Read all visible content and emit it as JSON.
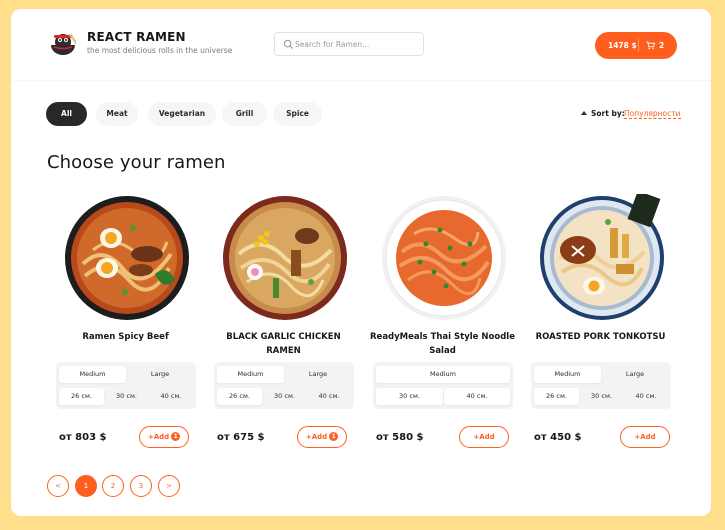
{
  "header": {
    "title": "REACT RAMEN",
    "subtitle": "the most delicious rolls in the universe",
    "search_placeholder": "Search for Ramen...",
    "cart_price": "1478 $",
    "cart_count": "2"
  },
  "categories": [
    "All",
    "Meat",
    "Vegetarian",
    "Grill",
    "Spice"
  ],
  "active_category": "All",
  "sort": {
    "label": "Sort by:",
    "value": "Популярности"
  },
  "section_title": "Choose your ramen",
  "products": [
    {
      "name": "Ramen Spicy Beef",
      "types": [
        "Medium",
        "Large"
      ],
      "active_type": "Medium",
      "sizes": [
        "26 см.",
        "30 см.",
        "40 см."
      ],
      "active_size": "26 см.",
      "price": "от 803 $",
      "add_label": "Add",
      "add_count": "1",
      "image": "spicy-beef-ramen"
    },
    {
      "name": "BLACK GARLIC CHICKEN RAMEN",
      "types": [
        "Medium",
        "Large"
      ],
      "active_type": "Medium",
      "sizes": [
        "26 см.",
        "30 см.",
        "40 см."
      ],
      "active_size": "26 см.",
      "price": "от 675 $",
      "add_label": "Add",
      "add_count": "1",
      "image": "black-garlic-chicken-ramen"
    },
    {
      "name": "ReadyMeals Thai Style Noodle Salad",
      "types": [
        "Medium"
      ],
      "active_type": "Medium",
      "sizes": [
        "30 см.",
        "40 см."
      ],
      "active_size": "",
      "price": "от 580 $",
      "add_label": "Add",
      "add_count": "",
      "image": "thai-noodle-salad"
    },
    {
      "name": "ROASTED PORK TONKOTSU",
      "types": [
        "Medium",
        "Large"
      ],
      "active_type": "Medium",
      "sizes": [
        "26 см.",
        "30 см.",
        "40 см."
      ],
      "active_size": "26 см.",
      "price": "от 450 $",
      "add_label": "Add",
      "add_count": "",
      "image": "pork-tonkotsu-ramen"
    }
  ],
  "pagination": {
    "prev": "<",
    "pages": [
      "1",
      "2",
      "3"
    ],
    "next": ">",
    "current": "1"
  },
  "colors": {
    "accent": "#fe5f1e",
    "background": "#ffdf8c",
    "dark": "#282828"
  }
}
